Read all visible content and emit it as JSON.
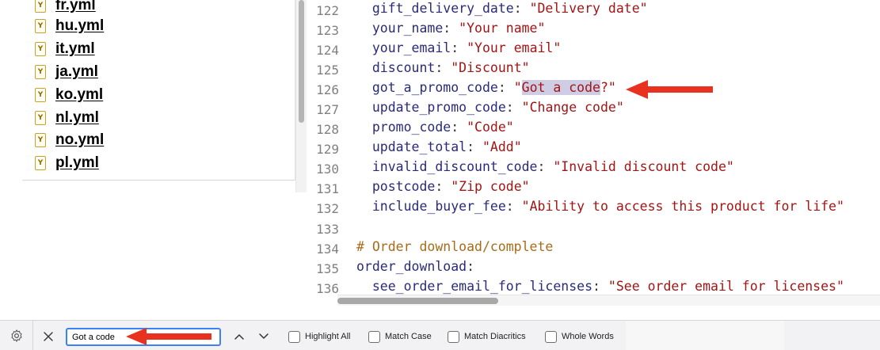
{
  "file_tree": {
    "items": [
      {
        "name": "fr.yml",
        "icon": "yaml-file-icon"
      },
      {
        "name": "hu.yml",
        "icon": "yaml-file-icon"
      },
      {
        "name": "it.yml",
        "icon": "yaml-file-icon"
      },
      {
        "name": "ja.yml",
        "icon": "yaml-file-icon"
      },
      {
        "name": "ko.yml",
        "icon": "yaml-file-icon"
      },
      {
        "name": "nl.yml",
        "icon": "yaml-file-icon"
      },
      {
        "name": "no.yml",
        "icon": "yaml-file-icon"
      },
      {
        "name": "pl.yml",
        "icon": "yaml-file-icon"
      }
    ],
    "icon_letter": "Y"
  },
  "editor": {
    "lines": [
      {
        "num": "122",
        "indent": "  ",
        "key": "gift_delivery_date",
        "value": "\"Delivery date\""
      },
      {
        "num": "123",
        "indent": "  ",
        "key": "your_name",
        "value": "\"Your name\""
      },
      {
        "num": "124",
        "indent": "  ",
        "key": "your_email",
        "value": "\"Your email\""
      },
      {
        "num": "125",
        "indent": "  ",
        "key": "discount",
        "value": "\"Discount\""
      },
      {
        "num": "126",
        "indent": "  ",
        "key": "got_a_promo_code",
        "value_pre": "\"",
        "value_match": "Got a code",
        "value_post": "?\""
      },
      {
        "num": "127",
        "indent": "  ",
        "key": "update_promo_code",
        "value": "\"Change code\""
      },
      {
        "num": "128",
        "indent": "  ",
        "key": "promo_code",
        "value": "\"Code\""
      },
      {
        "num": "129",
        "indent": "  ",
        "key": "update_total",
        "value": "\"Add\""
      },
      {
        "num": "130",
        "indent": "  ",
        "key": "invalid_discount_code",
        "value": "\"Invalid discount code\""
      },
      {
        "num": "131",
        "indent": "  ",
        "key": "postcode",
        "value": "\"Zip code\""
      },
      {
        "num": "132",
        "indent": "  ",
        "key": "include_buyer_fee",
        "value": "\"Ability to access this product for life\""
      },
      {
        "num": "133"
      },
      {
        "num": "134",
        "comment": "# Order download/complete"
      },
      {
        "num": "135",
        "key": "order_download",
        "value": ""
      },
      {
        "num": "136",
        "indent": "  ",
        "key": "see_order_email_for_licenses",
        "value": "\"See order email for licenses\""
      }
    ],
    "colors": {
      "key": "#2a2a7a",
      "string": "#a31515",
      "comment": "#a86b1a",
      "match_highlight": "#cfcde6"
    }
  },
  "find_bar": {
    "search_value": "Got a code",
    "options": [
      {
        "label": "Highlight All",
        "checked": false
      },
      {
        "label": "Match Case",
        "checked": false
      },
      {
        "label": "Match Diacritics",
        "checked": false
      },
      {
        "label": "Whole Words",
        "checked": false
      }
    ],
    "icons": {
      "settings": "gear-icon",
      "close": "close-icon",
      "previous": "chevron-up-icon",
      "next": "chevron-down-icon"
    }
  },
  "annotations": {
    "arrow_color": "#e8321f"
  }
}
